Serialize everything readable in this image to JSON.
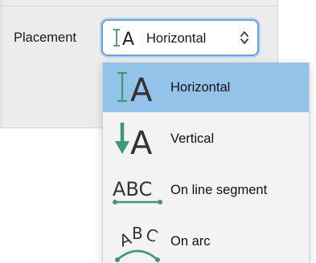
{
  "field": {
    "label": "Placement",
    "selected_value": "Horizontal",
    "selected_icon": "text-horizontal-icon"
  },
  "menu": {
    "items": [
      {
        "label": "Horizontal",
        "icon": "text-horizontal-icon",
        "selected": true
      },
      {
        "label": "Vertical",
        "icon": "text-vertical-icon",
        "selected": false
      },
      {
        "label": "On line segment",
        "icon": "text-on-line-segment-icon",
        "selected": false
      },
      {
        "label": "On arc",
        "icon": "text-on-arc-icon",
        "selected": false
      }
    ]
  },
  "icon_glyphs": {
    "letter_a": "A",
    "abc": "ABC"
  },
  "colors": {
    "accent_green": "#3c9a72",
    "selection": "#93c3e8",
    "focus_ring": "#6aa2e0"
  }
}
